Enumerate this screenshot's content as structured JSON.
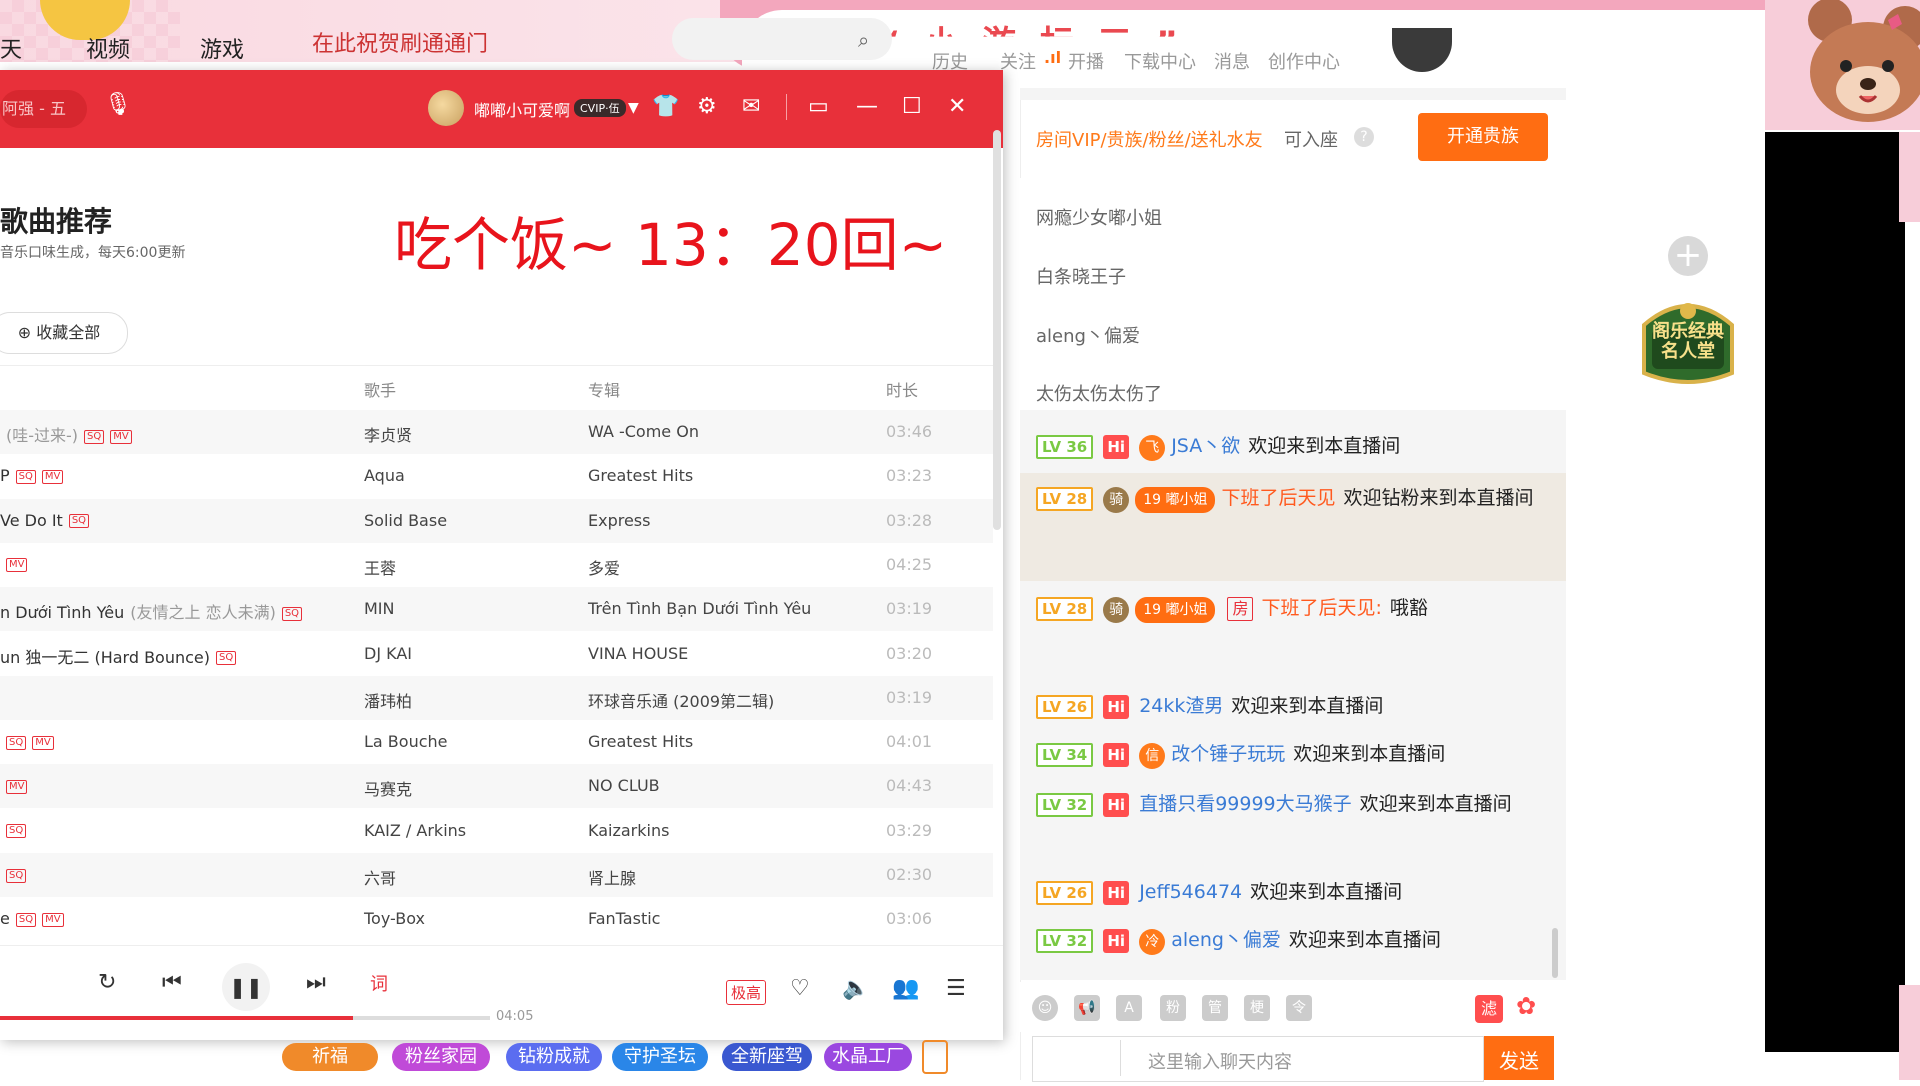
{
  "site_nav": {
    "items": [
      "天",
      "视频",
      "游戏",
      "在此祝贺刷通通门"
    ],
    "right_links": [
      "历史",
      "关注",
      "开播",
      "下载中心",
      "消息",
      "创作中心"
    ]
  },
  "banner_text": "某某 “ 小 游 标 三 ”",
  "music": {
    "search_text": "阿强 - 五",
    "username": "嘟嘟小可爱啊",
    "vip_badge": "CVIP·伍",
    "page_title": "歌曲推荐",
    "subtitle": "音乐口味生成，每天6:00更新",
    "overlay_note": "吃个饭~ 13：20回~",
    "collect_all": "收藏全部",
    "columns": {
      "singer": "歌手",
      "album": "专辑",
      "duration": "时长"
    },
    "rows": [
      {
        "title": "",
        "paren": "(哇-过来-)",
        "tags": [
          "SQ",
          "MV"
        ],
        "singer": "李贞贤",
        "album": "WA -Come On",
        "duration": "03:46"
      },
      {
        "title": "P",
        "paren": "",
        "tags": [
          "SQ",
          "MV"
        ],
        "singer": "Aqua",
        "album": "Greatest Hits",
        "duration": "03:23"
      },
      {
        "title": "Ve Do It",
        "paren": "",
        "tags": [
          "SQ"
        ],
        "singer": "Solid Base",
        "album": "Express",
        "duration": "03:28"
      },
      {
        "title": "",
        "paren": "",
        "tags": [
          "MV"
        ],
        "singer": "王蓉",
        "album": "多爱",
        "duration": "04:25"
      },
      {
        "title": "n Dưới Tình Yêu",
        "paren": "(友情之上 恋人未满)",
        "tags": [
          "SQ"
        ],
        "singer": "MIN",
        "album": "Trên Tình Bạn Dưới Tình Yêu",
        "duration": "03:19"
      },
      {
        "title": "un 独一无二 (Hard Bounce)",
        "paren": "",
        "tags": [
          "SQ"
        ],
        "singer": "DJ KAI",
        "album": "VINA HOUSE",
        "duration": "03:20"
      },
      {
        "title": "",
        "paren": "",
        "tags": [],
        "singer": "潘玮柏",
        "album": "环球音乐通 (2009第二辑)",
        "duration": "03:19"
      },
      {
        "title": "",
        "paren": "",
        "tags": [
          "SQ",
          "MV"
        ],
        "singer": "La Bouche",
        "album": "Greatest Hits",
        "duration": "04:01"
      },
      {
        "title": "",
        "paren": "",
        "tags": [
          "MV"
        ],
        "singer": "马赛克",
        "album": "NO CLUB",
        "duration": "04:43"
      },
      {
        "title": "",
        "paren": "",
        "tags": [
          "SQ"
        ],
        "singer": "KAIZ / Arkins",
        "album": "Kaizarkins",
        "duration": "03:29"
      },
      {
        "title": "",
        "paren": "",
        "tags": [
          "SQ"
        ],
        "singer": "六哥",
        "album": "肾上腺",
        "duration": "02:30"
      },
      {
        "title": "e",
        "paren": "",
        "tags": [
          "SQ",
          "MV"
        ],
        "singer": "Toy-Box",
        "album": "FanTastic",
        "duration": "03:06"
      }
    ],
    "player": {
      "total_time": "04:05",
      "quality": "极高",
      "lyric_icon": "词",
      "progress": 0.72
    }
  },
  "bottom_buttons": [
    {
      "label": "祈福",
      "color": "#f08a2a"
    },
    {
      "label": "粉丝家园",
      "color": "#c04ad8"
    },
    {
      "label": "钻粉成就",
      "color": "#5b6df0"
    },
    {
      "label": "守护圣坛",
      "color": "#2a86e8"
    },
    {
      "label": "全新座驾",
      "color": "#3a58d0"
    },
    {
      "label": "水晶工厂",
      "color": "#9a48e0"
    }
  ],
  "sidebar": {
    "hall_of_fame": "阁乐经典名人堂"
  },
  "chat": {
    "vip_note_highlight": "房间VIP/贵族/粉丝/送礼水友",
    "vip_note_rest": "可入座",
    "open_noble": "开通贵族",
    "seats": [
      "网瘾少女嘟小姐",
      "白条晓王子",
      "aleng丶偏爱",
      "太伤太伤太伤了"
    ],
    "messages": [
      {
        "lv": "LV 36",
        "badge": "飞",
        "user": "JSA丶欲",
        "text": "欢迎来到本直播间"
      },
      {
        "lv": "LV 28",
        "badge": "骑",
        "fan": "19 嘟小姐",
        "user": "下班了后天见",
        "text": "欢迎钻粉来到本直播间"
      },
      {
        "lv": "LV 28",
        "badge": "骑",
        "fan": "19 嘟小姐",
        "room": "房",
        "user": "下班了后天见:",
        "text": "哦豁"
      },
      {
        "lv": "LV 26",
        "user": "24kk渣男",
        "text": "欢迎来到本直播间"
      },
      {
        "lv": "LV 34",
        "badge": "信",
        "user": "改个锤子玩玩",
        "text": "欢迎来到本直播间"
      },
      {
        "lv": "LV 32",
        "user": "直播只看99999大马猴子",
        "text": "欢迎来到本直播间"
      },
      {
        "lv": "LV 26",
        "user": "Jeff546474",
        "text": "欢迎来到本直播间"
      },
      {
        "lv": "LV 32",
        "badge": "冷",
        "user": "aleng丶偏爱",
        "text": "欢迎来到本直播间"
      }
    ],
    "hi_label": "Hi",
    "tools": [
      "粉",
      "管",
      "梗",
      "令"
    ],
    "filter_label": "滤",
    "input_placeholder": "这里输入聊天内容",
    "send": "发送"
  }
}
